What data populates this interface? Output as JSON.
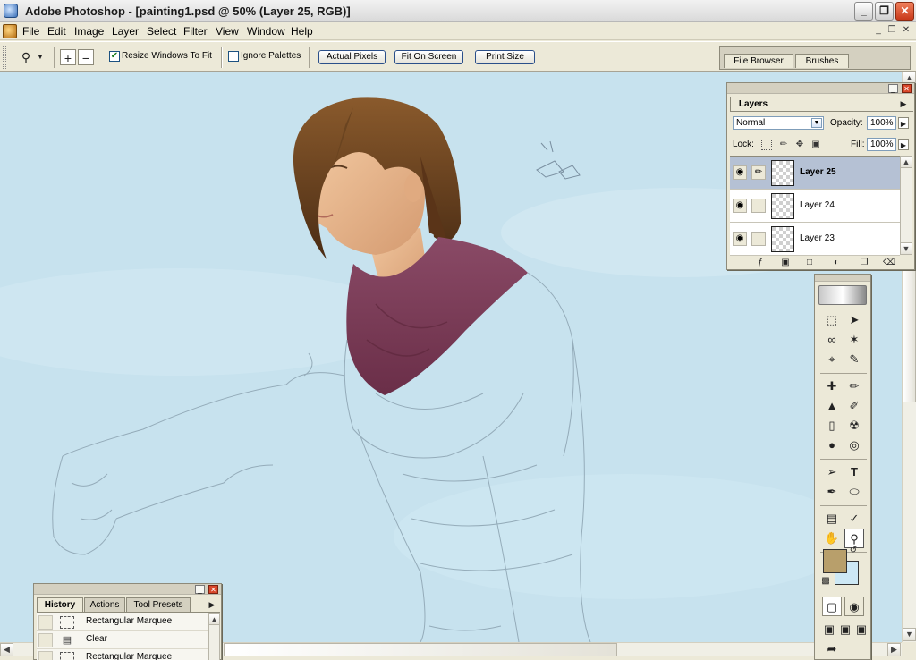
{
  "window": {
    "title": "Adobe Photoshop - [painting1.psd @ 50% (Layer 25, RGB)]",
    "minimize_glyph": "_",
    "maximize_glyph": "❐",
    "close_glyph": "✕"
  },
  "menu": {
    "items": [
      "File",
      "Edit",
      "Image",
      "Layer",
      "Select",
      "Filter",
      "View",
      "Window",
      "Help"
    ],
    "mdi_minimize": "_",
    "mdi_restore": "❐",
    "mdi_close": "✕"
  },
  "options_bar": {
    "tool_icon": "zoom-tool-icon",
    "resize_windows_label": "Resize Windows To Fit",
    "resize_windows_checked": true,
    "ignore_palettes_label": "Ignore Palettes",
    "ignore_palettes_checked": false,
    "buttons": [
      "Actual Pixels",
      "Fit On Screen",
      "Print Size"
    ],
    "well_tabs": [
      "File Browser",
      "Brushes"
    ]
  },
  "layers_panel": {
    "tab": "Layers",
    "blend_mode": "Normal",
    "opacity_label": "Opacity:",
    "opacity_value": "100%",
    "lock_label": "Lock:",
    "fill_label": "Fill:",
    "fill_value": "100%",
    "layers": [
      {
        "name": "Layer 25",
        "selected": true,
        "visible": true
      },
      {
        "name": "Layer 24",
        "selected": false,
        "visible": true
      },
      {
        "name": "Layer 23",
        "selected": false,
        "visible": true
      }
    ]
  },
  "toolbox": {
    "foreground_color": "#b89f6b",
    "background_color": "#cde8f5"
  },
  "history_panel": {
    "tabs": [
      "History",
      "Actions",
      "Tool Presets"
    ],
    "active_tab": "History",
    "items": [
      "Rectangular Marquee",
      "Clear",
      "Rectangular Marquee"
    ]
  },
  "colors": {
    "canvas_bg": "#c7e2ee",
    "selected_layer": "#b5c1d4",
    "ui_face": "#ece9d8"
  }
}
